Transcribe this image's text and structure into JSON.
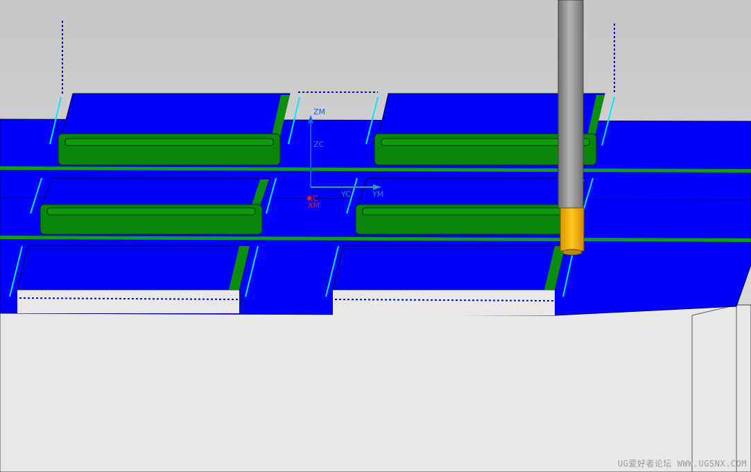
{
  "viewport": {
    "name": "3d-graphics-window",
    "colors": {
      "background_top": "#c8c8c8",
      "background_bottom": "#e6e6e6",
      "face_blue": "#0000ff",
      "wall_green": "#008c00",
      "tool_shank": "#8c8c8c",
      "tool_holder": "#f0b400",
      "toolpath_dashed": "#0000cc",
      "toolpath_cyan": "#00e0ff"
    }
  },
  "triad": {
    "labels": {
      "zm": "ZM",
      "zc": "ZC",
      "yc": "YC",
      "ym": "YM",
      "xc": "XC",
      "xm": "XM"
    },
    "colors": {
      "z": "#1060ff",
      "y": "#2aa6a6",
      "x": "#e02020"
    }
  },
  "watermark": "UG爱好者论坛 WWW.UGSNX.COM"
}
